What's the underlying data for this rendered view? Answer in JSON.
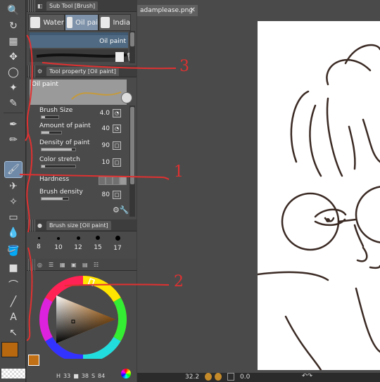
{
  "subtool_panel": {
    "title": "Sub Tool [Brush]",
    "tabs": [
      {
        "label": "Water"
      },
      {
        "label": "Oil pai"
      },
      {
        "label": "India"
      }
    ],
    "brush_name": "Oil paint"
  },
  "tool_property": {
    "title": "Tool property [Oil paint]",
    "preview_label": "Oil paint",
    "properties": [
      {
        "name": "Brush Size",
        "value": "4.0",
        "fill": 0.2
      },
      {
        "name": "Amount of paint",
        "value": "40",
        "fill": 0.4
      },
      {
        "name": "Density of paint",
        "value": "90",
        "fill": 0.9
      },
      {
        "name": "Color stretch",
        "value": "10",
        "fill": 0.1
      },
      {
        "name": "Hardness",
        "value": ""
      },
      {
        "name": "Brush density",
        "value": "80",
        "fill": 0.8
      }
    ]
  },
  "brush_size_panel": {
    "title": "Brush size [Oil paint]",
    "sizes": [
      "8",
      "10",
      "12",
      "15",
      "17"
    ]
  },
  "color": {
    "main": "#b8690f",
    "sub": "#c27015",
    "h_label": "H",
    "h_value": "33",
    "s_value": "38",
    "v_label": "S",
    "v_value": "84"
  },
  "document": {
    "tab_label": "adamplease.png"
  },
  "status": {
    "zoom": "32.2",
    "rotation": "0.0"
  },
  "annotations": [
    "1",
    "2",
    "3"
  ]
}
